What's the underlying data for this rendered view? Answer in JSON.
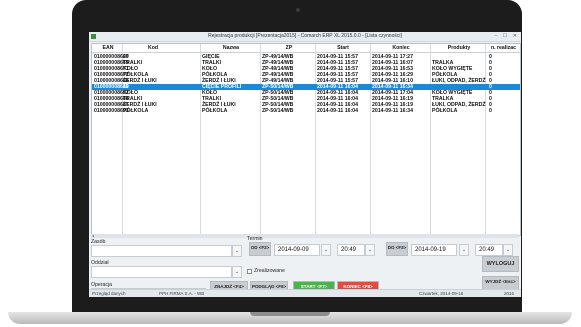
{
  "window": {
    "title": "Rejestracja produkcji [Prezentacja2015] - Comarch ERP XL 2015.0.0 - [Lista czynności]",
    "controls": "– ☐ ✕"
  },
  "table": {
    "columns": [
      "EAN",
      "Kod",
      "Nazwa",
      "ZP",
      "Start",
      "Koniec",
      "Produkty",
      "n. realizac"
    ],
    "rows": [
      [
        "010000008667",
        "20",
        "GIĘCIE",
        "ZP-49/14/WB",
        "2014-09-11 15:57",
        "2014-09-11 17:27",
        "",
        "0"
      ],
      [
        "010000008669",
        "TRALKI",
        "TRALKI",
        "ZP-49/14/WB",
        "2014-09-11 15:57",
        "2014-09-11 16:07",
        "TRALKA",
        "0"
      ],
      [
        "010000008671",
        "KOŁO",
        "KOŁO",
        "ZP-49/14/WB",
        "2014-09-11 15:57",
        "2014-09-11 16:53",
        "KOŁO WYGIĘTE",
        "0"
      ],
      [
        "010000008672",
        "PÓŁKOLA",
        "PÓŁKOLA",
        "ZP-49/14/WB",
        "2014-09-11 15:57",
        "2014-09-11 16:29",
        "PÓŁKOLA",
        "0"
      ],
      [
        "010000008668",
        "ŻERDŹ I ŁUKI",
        "ŻERDŹ I ŁUKI",
        "ZP-49/14/WB",
        "2014-09-11 15:57",
        "2014-09-11 16:10",
        "ŁUKI, ODPAD, ŻERDŹ",
        "0"
      ],
      [
        "010000008689",
        "10",
        "CIĘCIE PROFILI",
        "ZP-50/14/WB",
        "2014-09-11 16:04",
        "2014-09-11 16:34",
        "",
        "0"
      ],
      [
        "010000008692",
        "KOŁO",
        "KOŁO",
        "ZP-50/14/WB",
        "2014-09-11 16:04",
        "2014-09-11 17:04",
        "KOŁO WYGIĘTE",
        "0"
      ],
      [
        "010000008688",
        "TRALKI",
        "TRALKI",
        "ZP-50/14/WB",
        "2014-09-11 16:04",
        "2014-09-11 16:19",
        "TRALKA",
        "0"
      ],
      [
        "010000008687",
        "ŻERDŹ I ŁUKI",
        "ŻERDŹ I ŁUKI",
        "ZP-50/14/WB",
        "2014-09-11 16:04",
        "2014-09-11 16:19",
        "ŁUKI, ODPAD, ŻERDŹ",
        "0"
      ],
      [
        "010000008693",
        "PÓŁKOLA",
        "PÓŁKOLA",
        "ZP-50/14/WB",
        "2014-09-11 16:04",
        "2014-09-11 16:34",
        "PÓŁKOLA",
        "0"
      ]
    ],
    "selected_index": 5
  },
  "form": {
    "zasob_label": "Zasób",
    "termin_label": "Termin",
    "od_button": "OD <F2>",
    "od_date": "2014-09-09",
    "od_time": "20:49",
    "do_button": "DO <F3>",
    "do_date": "2014-09-19",
    "do_time": "20:49",
    "oddzial_label": "Oddział",
    "zrealizowane_label": "Zrealizowane",
    "operacja_label": "Operacja"
  },
  "buttons": {
    "znajdz": "ZNAJDŹ <F4>",
    "podglad": "PODGLĄD <F6>",
    "start": "START <F7>",
    "koniec": "KONIEC <F8>",
    "wyloguj": "WYLOGUJ",
    "wyjdz": "WYJDŹ <Esc>"
  },
  "statusbar": {
    "left": "Przegląd danych",
    "middle": "PPH FIRMA S.A. - WB",
    "date": "Czwartek, 2014-09-16",
    "year": "2015"
  }
}
